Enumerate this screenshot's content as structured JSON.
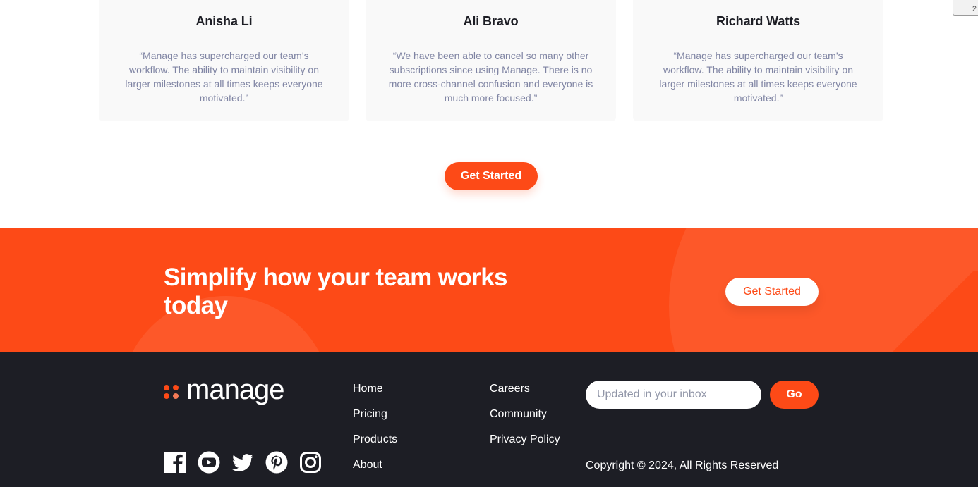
{
  "testimonials": [
    {
      "name": "Anisha Li",
      "quote": "“Manage has supercharged our team’s workflow. The ability to maintain visibility on larger milestones at all times keeps everyone motivated.”"
    },
    {
      "name": "Ali Bravo",
      "quote": "“We have been able to cancel so many other subscriptions since using Manage. There is no more cross-channel confusion and everyone is much more focused.”"
    },
    {
      "name": "Richard Watts",
      "quote": "“Manage has supercharged our team’s workflow. The ability to maintain visibility on larger milestones at all times keeps everyone motivated.”"
    }
  ],
  "testimonials_cta_label": "Get Started",
  "corner_widget_text": "2",
  "cta_band": {
    "headline": "Simplify how your team works today",
    "button_label": "Get Started"
  },
  "footer": {
    "logo_text": "manage",
    "social_icons": [
      "facebook-icon",
      "youtube-icon",
      "twitter-icon",
      "pinterest-icon",
      "instagram-icon"
    ],
    "links_col1": [
      "Home",
      "Pricing",
      "Products",
      "About"
    ],
    "links_col2": [
      "Careers",
      "Community",
      "Privacy Policy"
    ],
    "newsletter_placeholder": "Updated in your inbox",
    "go_label": "Go",
    "copyright": "Copyright © 2024, All Rights Reserved"
  },
  "colors": {
    "accent": "#fd4a17",
    "footer_bg": "#1d1e25",
    "card_bg": "#f9f9f9",
    "quote_text": "#7f84a3"
  }
}
